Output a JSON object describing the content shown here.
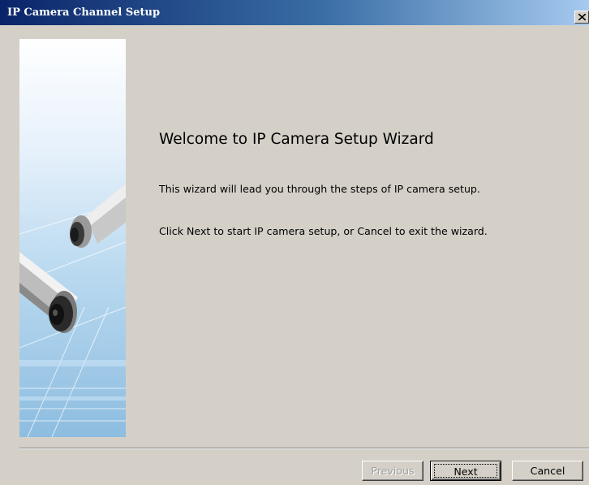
{
  "window": {
    "title": "IP Camera Channel Setup",
    "close_icon": "close-icon"
  },
  "side_image": {
    "icon": "ip-camera-illustration"
  },
  "content": {
    "heading": "Welcome to IP Camera Setup Wizard",
    "line1": "This wizard will lead you through the steps of IP camera setup.",
    "line2": "Click Next to start IP camera setup, or Cancel to exit the wizard."
  },
  "buttons": {
    "previous": "Previous",
    "next": "Next",
    "cancel": "Cancel"
  },
  "colors": {
    "titlebar_start": "#0a246a",
    "titlebar_end": "#a6caf0",
    "dialog_bg": "#d4d0c8"
  }
}
